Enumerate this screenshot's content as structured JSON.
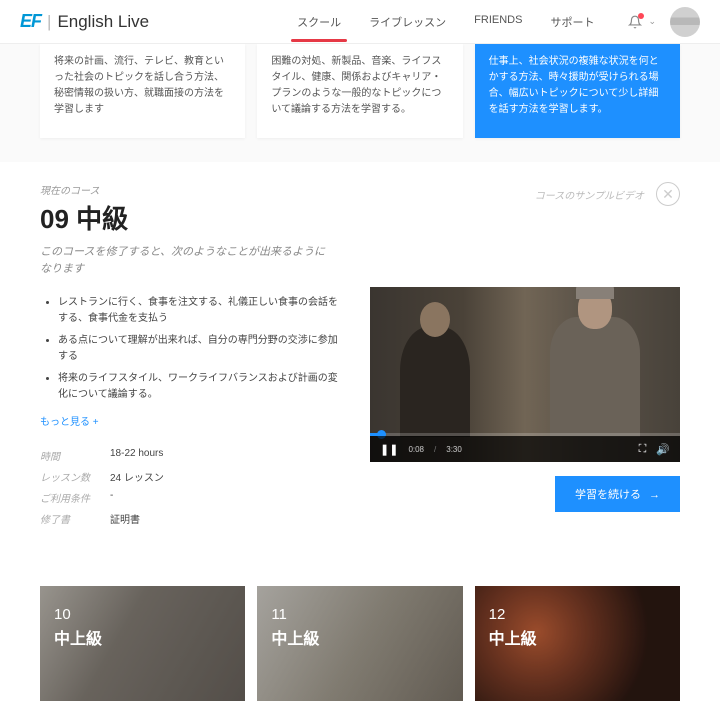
{
  "header": {
    "brand_prefix": "EF",
    "brand_name": "English Live",
    "nav": [
      "スクール",
      "ライブレッスン",
      "FRIENDS",
      "サポート"
    ],
    "active_nav_index": 0
  },
  "cards": [
    "将来の計画、流行、テレビ、教育といった社会のトピックを話し合う方法、秘密情報の扱い方、就職面接の方法を学習します",
    "困難の対処、新製品、音楽、ライフスタイル、健康、関係およびキャリア・プランのような一般的なトピックについて議論する方法を学習する。",
    "仕事上、社会状況の複雑な状況を何とかする方法、時々援助が受けられる場合、幅広いトピックについて少し詳細を話す方法を学習します。"
  ],
  "course": {
    "current_label": "現在のコース",
    "title": "09 中級",
    "subtitle": "このコースを修了すると、次のようなことが出来るようになります",
    "sample_label": "コースのサンプルビデオ",
    "bullets": [
      "レストランに行く、食事を注文する、礼儀正しい食事の会話をする、食事代金を支払う",
      "ある点について理解が出来れば、自分の専門分野の交渉に参加する",
      "将来のライフスタイル、ワークライフバランスおよび計画の変化について議論する。"
    ],
    "more": "もっと見る +",
    "meta": {
      "time_label": "時間",
      "time_val": "18-22 hours",
      "lessons_label": "レッスン数",
      "lessons_val": "24 レッスン",
      "req_label": "ご利用条件",
      "req_val": "-",
      "cert_label": "修了書",
      "cert_val": "証明書"
    },
    "video": {
      "current": "0:08",
      "total": "3:30"
    },
    "cta": "学習を続ける"
  },
  "grid": [
    {
      "num": "10",
      "level": "中上級"
    },
    {
      "num": "11",
      "level": "中上級"
    },
    {
      "num": "12",
      "level": "中上級"
    }
  ]
}
